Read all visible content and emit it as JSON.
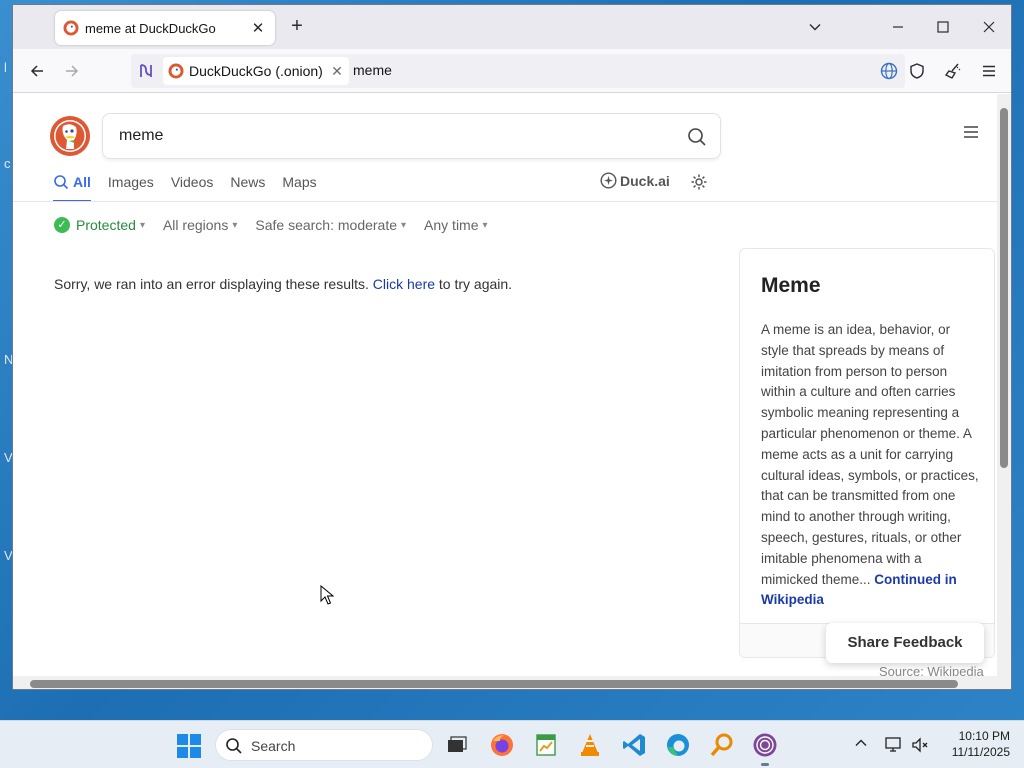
{
  "window": {
    "tab_title": "meme at DuckDuckGo",
    "url_chip": "DuckDuckGo (.onion)",
    "url_text": "meme"
  },
  "search": {
    "query": "meme",
    "tabs": [
      {
        "label": "All",
        "active": true
      },
      {
        "label": "Images",
        "active": false
      },
      {
        "label": "Videos",
        "active": false
      },
      {
        "label": "News",
        "active": false
      },
      {
        "label": "Maps",
        "active": false
      }
    ],
    "duck_ai": "Duck.ai",
    "filters": {
      "protected": "Protected",
      "regions": "All regions",
      "safe_search": "Safe search: moderate",
      "time": "Any time"
    }
  },
  "error": {
    "before": "Sorry, we ran into an error displaying these results.",
    "link": "Click here",
    "after": "to try again."
  },
  "knowledge_panel": {
    "title": "Meme",
    "text": "A meme is an idea, behavior, or style that spreads by means of imitation from person to person within a culture and often carries symbolic meaning representing a particular phenomenon or theme. A meme acts as a unit for carrying cultural ideas, symbols, or practices, that can be transmitted from one mind to another through writing, speech, gestures, rituals, or other imitable phenomena with a mimicked theme...",
    "more_link": "Continued in Wikipedia",
    "source": "Source: Wikipedia",
    "share_feedback": "Share Feedback"
  },
  "taskbar": {
    "search_placeholder": "Search",
    "time": "10:10 PM",
    "date": "11/11/2025"
  },
  "colors": {
    "accent": "#3969ef",
    "ddg_orange": "#de5833",
    "protected_green": "#3fbb55",
    "link": "#1a3aa8"
  }
}
